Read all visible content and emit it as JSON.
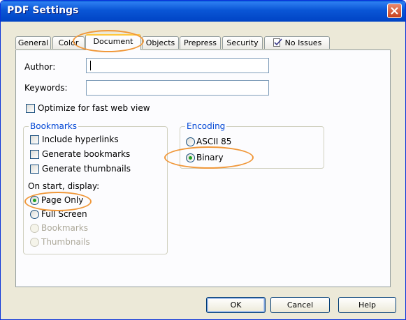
{
  "window": {
    "title": "PDF Settings"
  },
  "tabs": [
    {
      "label": "General"
    },
    {
      "label": "Color"
    },
    {
      "label": "Document"
    },
    {
      "label": "Objects"
    },
    {
      "label": "Prepress"
    },
    {
      "label": "Security"
    },
    {
      "label": "No Issues",
      "icon": "check-document-icon"
    }
  ],
  "active_tab": "Document",
  "fields": {
    "author_label": "Author:",
    "author_value": "",
    "keywords_label": "Keywords:",
    "keywords_value": ""
  },
  "optimize": {
    "label": "Optimize for fast web view",
    "checked": false
  },
  "bookmarks": {
    "title": "Bookmarks",
    "options": [
      {
        "label": "Include hyperlinks",
        "checked": false
      },
      {
        "label": "Generate bookmarks",
        "checked": false
      },
      {
        "label": "Generate thumbnails",
        "checked": false
      }
    ],
    "display_label": "On start, display:",
    "display_options": [
      {
        "label": "Page Only",
        "selected": true,
        "enabled": true
      },
      {
        "label": "Full Screen",
        "selected": false,
        "enabled": true
      },
      {
        "label": "Bookmarks",
        "selected": false,
        "enabled": false
      },
      {
        "label": "Thumbnails",
        "selected": false,
        "enabled": false
      }
    ]
  },
  "encoding": {
    "title": "Encoding",
    "options": [
      {
        "label": "ASCII 85",
        "selected": false
      },
      {
        "label": "Binary",
        "selected": true
      }
    ]
  },
  "buttons": {
    "ok": "OK",
    "cancel": "Cancel",
    "help": "Help"
  },
  "colors": {
    "titlebar": "#0a56d6",
    "group_label": "#0046d5",
    "highlight": "#f0983a",
    "radio_dot": "#21a121"
  }
}
